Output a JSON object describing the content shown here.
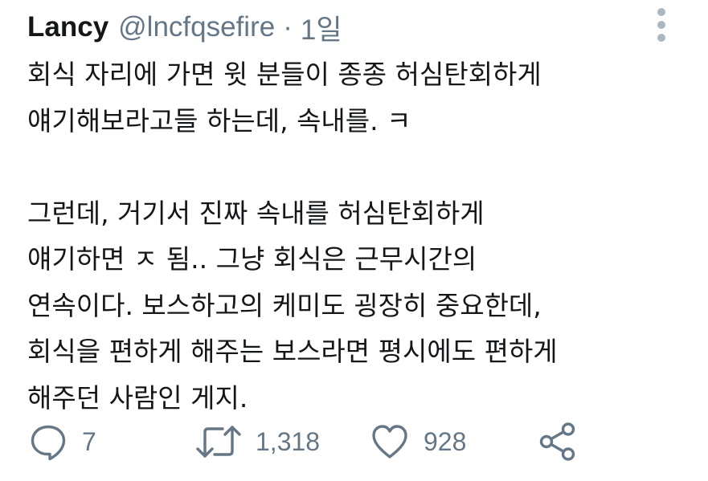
{
  "tweet": {
    "author_name": "Lancy",
    "handle": "@lncfqsefire",
    "separator": "·",
    "time": "1일",
    "lines": [
      "회식 자리에 가면 윗 분들이 종종 허심탄회하게",
      "얘기해보라고들 하는데, 속내를. ㅋ",
      "",
      "그런데, 거기서 진짜 속내를 허심탄회하게",
      "얘기하면 ㅈ 됨.. 그냥 회식은 근무시간의",
      "연속이다. 보스하고의 케미도 굉장히 중요한데,",
      "회식을 편하게 해주는 보스라면 평시에도 편하게",
      "해주던 사람인 게지."
    ]
  },
  "actions": {
    "reply_count": "7",
    "retweet_count": "1,318",
    "like_count": "928"
  },
  "icons": {
    "reply": "reply-icon",
    "retweet": "retweet-icon",
    "like": "heart-icon",
    "share": "share-icon",
    "more": "more-vertical-icon"
  },
  "colors": {
    "text": "#14171a",
    "secondary": "#657786",
    "more_dots": "#aab8c2"
  }
}
